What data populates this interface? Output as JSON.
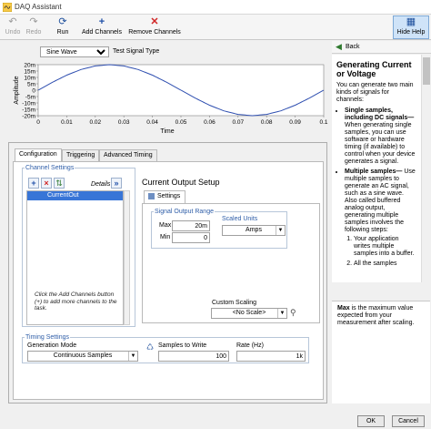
{
  "window": {
    "title": "DAQ Assistant"
  },
  "toolbar": {
    "undo": "Undo",
    "redo": "Redo",
    "run": "Run",
    "add_channels": "Add Channels",
    "remove_channels": "Remove Channels",
    "hide_help": "Hide Help"
  },
  "graph": {
    "signal_type": "Sine Wave",
    "signal_type_label": "Test Signal Type",
    "xlabel": "Time",
    "ylabel": "Amplitude"
  },
  "chart_data": {
    "type": "line",
    "xlabel": "Time",
    "ylabel": "Amplitude",
    "xlim": [
      0,
      0.1
    ],
    "ylim": [
      -20,
      20
    ],
    "x_ticks": [
      "0",
      "0.01",
      "0.02",
      "0.03",
      "0.04",
      "0.05",
      "0.06",
      "0.07",
      "0.08",
      "0.09",
      "0.1"
    ],
    "y_ticks": [
      "20m",
      "15m",
      "10m",
      "5m",
      "0",
      "-5m",
      "-10m",
      "-15m",
      "-20m"
    ],
    "grid": false,
    "series": [
      {
        "x": [
          0,
          0.005,
          0.01,
          0.015,
          0.02,
          0.025,
          0.03,
          0.035,
          0.04,
          0.045,
          0.05,
          0.055,
          0.06,
          0.065,
          0.07,
          0.075,
          0.08,
          0.085,
          0.09,
          0.095,
          0.1
        ],
        "y": [
          0,
          6.2,
          11.8,
          16.2,
          19.0,
          20.0,
          19.0,
          16.2,
          11.8,
          6.2,
          0,
          -6.2,
          -11.8,
          -16.2,
          -19.0,
          -20.0,
          -19.0,
          -16.2,
          -11.8,
          -6.2,
          0
        ]
      }
    ],
    "line_color": "#2f4fb0"
  },
  "tabs": [
    "Configuration",
    "Triggering",
    "Advanced Timing"
  ],
  "channel_settings": {
    "legend": "Channel Settings",
    "details": "Details",
    "channel": "CurrentOut",
    "hint": "Click the Add Channels button (+) to add more channels to the task."
  },
  "setup": {
    "title": "Current Output Setup",
    "settings_tab": "Settings",
    "range_legend": "Signal Output Range",
    "max_label": "Max",
    "max_value": "20m",
    "min_label": "Min",
    "min_value": "0",
    "scaled_units_label": "Scaled Units",
    "scaled_units_value": "Amps",
    "custom_scaling_label": "Custom Scaling",
    "custom_scaling_value": "<No Scale>"
  },
  "timing": {
    "legend": "Timing Settings",
    "mode_label": "Generation Mode",
    "mode_value": "Continuous Samples",
    "samples_label": "Samples to Write",
    "samples_value": "100",
    "rate_label": "Rate (Hz)",
    "rate_value": "1k"
  },
  "help": {
    "back": "Back",
    "title": "Generating Current or Voltage",
    "intro": "You can generate two main kinds of signals for channels:",
    "single_title": "Single samples, including DC signals—",
    "single_text": "When generating single samples, you can use software or hardware timing (if available) to control when your device generates a signal.",
    "multiple_title": "Multiple samples—",
    "multiple_text": "Use multiple samples to generate an AC signal, such as a sine wave. Also called buffered analog output, generating multiple samples involves the following steps:",
    "step1": "Your application writes multiple samples into a buffer.",
    "step2": "All the samples",
    "field_name": "Max",
    "field_text": "is the maximum value expected from your measurement after scaling."
  },
  "buttons": {
    "ok": "OK",
    "cancel": "Cancel"
  }
}
